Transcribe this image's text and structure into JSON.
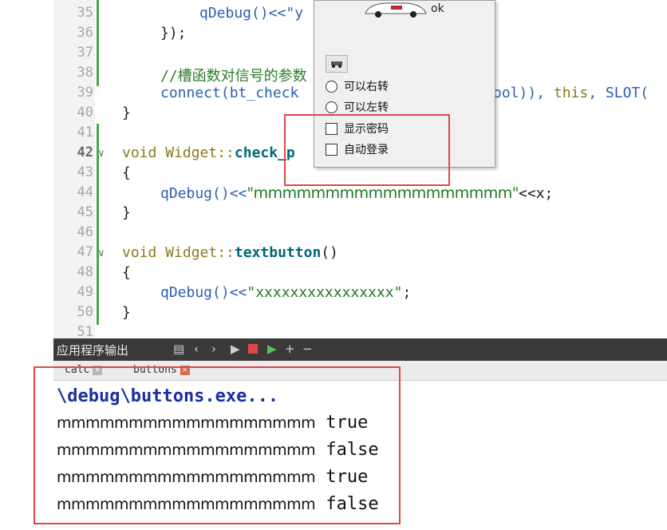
{
  "editor": {
    "lines": [
      {
        "num": "35",
        "code": "qDebug()<<\"y"
      },
      {
        "num": "36",
        "code": "});"
      },
      {
        "num": "37",
        "code": ""
      },
      {
        "num": "38",
        "code": "//槽函数对信号的参数"
      },
      {
        "num": "39",
        "code_a": "connect(bt_check",
        "code_b": "ool)), ",
        "code_c": "this",
        "code_d": ", SLOT("
      },
      {
        "num": "40",
        "code": "}"
      },
      {
        "num": "41",
        "code": ""
      },
      {
        "num": "42",
        "kw": "void",
        "cls": " Widget::",
        "fn": "check_p"
      },
      {
        "num": "43",
        "code": "{"
      },
      {
        "num": "44",
        "call": "qDebug()<<",
        "str": "\"mmmmmmmmmmmmmmmmmm\"",
        "rest": "<<x;"
      },
      {
        "num": "45",
        "code": "}"
      },
      {
        "num": "46",
        "code": ""
      },
      {
        "num": "47",
        "kw": "void",
        "cls": " Widget::",
        "fn": "textbutton",
        "rest": "()"
      },
      {
        "num": "48",
        "code": "{"
      },
      {
        "num": "49",
        "call": "qDebug()<<",
        "str": "\"xxxxxxxxxxxxxxxx\"",
        "rest": ";"
      },
      {
        "num": "50",
        "code": "}"
      },
      {
        "num": "51",
        "code": ""
      }
    ]
  },
  "popup": {
    "ok_label": "ok",
    "radio1": "可以右转",
    "radio2": "可以左转",
    "check1": "显示密码",
    "check2": "自动登录"
  },
  "panel": {
    "title": "应用程序输出",
    "tabs": [
      {
        "label": "calc"
      },
      {
        "label": "buttons"
      }
    ]
  },
  "output": {
    "header": "\\debug\\buttons.exe...",
    "rows": [
      {
        "m": "mmmmmmmmmmmmmmmmmm",
        "v": "true"
      },
      {
        "m": "mmmmmmmmmmmmmmmmmm",
        "v": "false"
      },
      {
        "m": "mmmmmmmmmmmmmmmmmm",
        "v": "true"
      },
      {
        "m": "mmmmmmmmmmmmmmmmmm",
        "v": "false"
      }
    ]
  },
  "colors": {
    "highlight_box": "#e04848",
    "toolbar_bg": "#3a3a3a",
    "keyword": "#8a7a1a",
    "string": "#1f7a1f"
  }
}
